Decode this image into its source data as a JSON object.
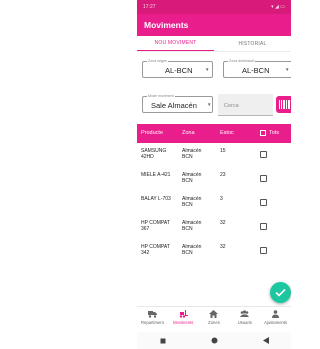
{
  "status": {
    "time": "17:27"
  },
  "app": {
    "title": "Moviments"
  },
  "tabs": [
    "NOU MOVIMENT",
    "HISTORIAL"
  ],
  "origin": {
    "legend": "Zona origen",
    "value": "AL-BCN"
  },
  "destination": {
    "legend": "Zona destinació",
    "value": "AL-BCN"
  },
  "mode": {
    "legend": "Mode moviment",
    "value": "Sale Almacén"
  },
  "search": {
    "placeholder": "Cerca"
  },
  "table": {
    "headers": [
      "Producte",
      "Zona",
      "Estoc",
      "Tots"
    ],
    "rows": [
      {
        "product": "SAMSUNG 42HD",
        "zone": "Almacén BCN",
        "stock": "15"
      },
      {
        "product": "MIELE A-421",
        "zone": "Almacén BCN",
        "stock": "23"
      },
      {
        "product": "BALAY L-703",
        "zone": "Almacén BCN",
        "stock": "3"
      },
      {
        "product": "HP COMPAT 367",
        "zone": "Almacén BCN",
        "stock": "32"
      },
      {
        "product": "HP COMPAT 342",
        "zone": "Almacén BCN",
        "stock": "32"
      }
    ]
  },
  "bottom_nav": [
    {
      "label": "Repartiment",
      "icon": "truck-icon"
    },
    {
      "label": "Moviments",
      "icon": "forklift-icon"
    },
    {
      "label": "Zones",
      "icon": "home-icon"
    },
    {
      "label": "Usuaris",
      "icon": "users-icon"
    },
    {
      "label": "Ajustaments",
      "icon": "settings-person-icon"
    }
  ],
  "colors": {
    "primary": "#e91e8c",
    "status": "#d81b7a",
    "fab": "#1dc79f"
  }
}
